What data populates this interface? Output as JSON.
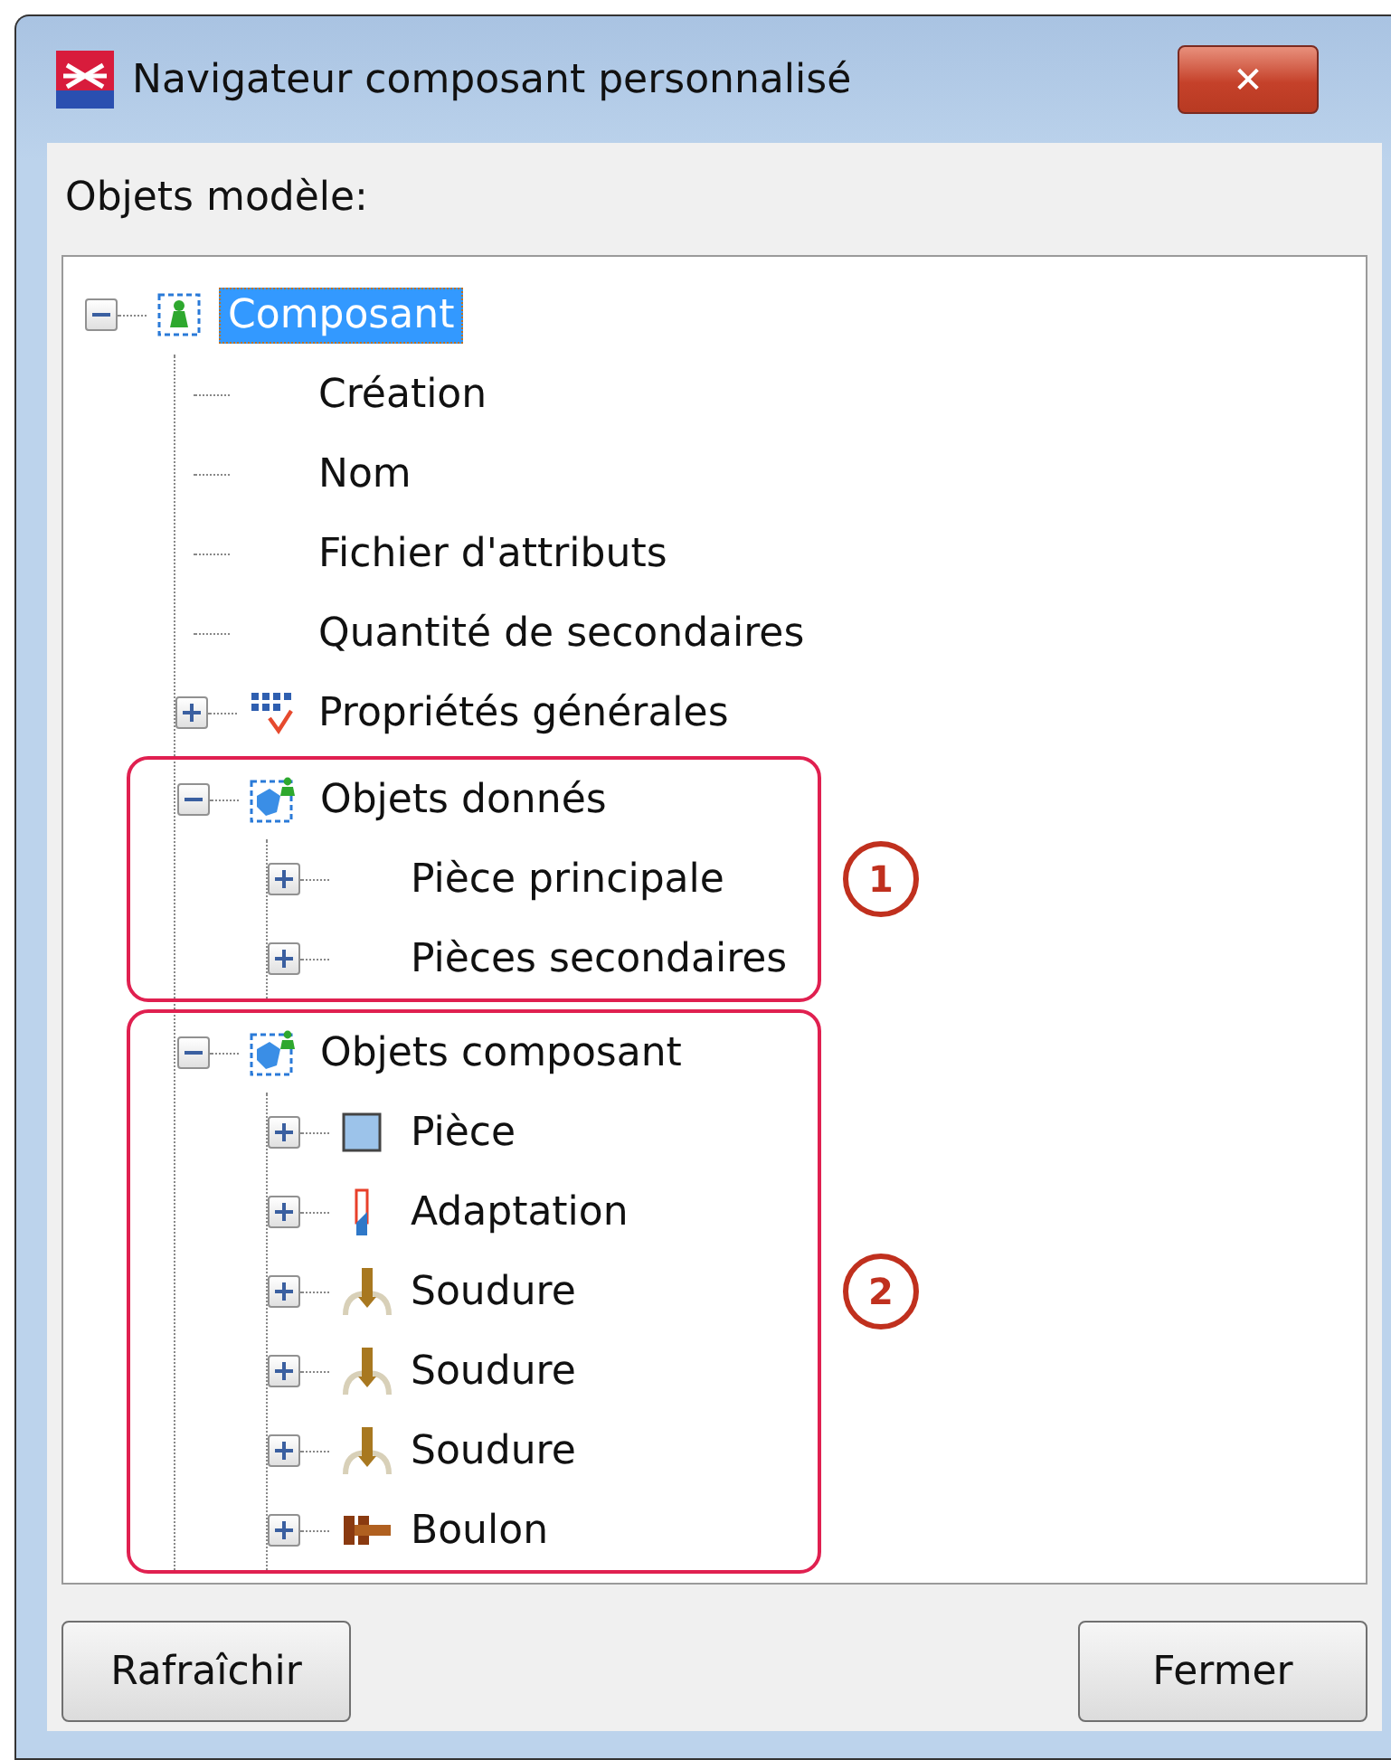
{
  "window": {
    "title": "Navigateur composant personnalisé",
    "close": "✕"
  },
  "label": "Objets modèle:",
  "tree": [
    {
      "label": "Composant",
      "kind": "component",
      "selected": true,
      "expanded": true,
      "children": [
        {
          "label": "Création",
          "selected": false
        },
        {
          "label": "Nom",
          "selected": false
        },
        {
          "label": "Fichier d'attributs",
          "selected": false
        },
        {
          "label": "Quantité de secondaires",
          "selected": false
        },
        {
          "label": "Propriétés générales",
          "kind": "properties",
          "selected": false,
          "expanded": false
        },
        {
          "label": "Objets donnés",
          "kind": "objects",
          "selected": false,
          "expanded": true,
          "callout": "1",
          "children": [
            {
              "label": "Pièce principale",
              "selected": false,
              "expanded": false
            },
            {
              "label": "Pièces secondaires",
              "selected": false,
              "expanded": false
            }
          ]
        },
        {
          "label": "Objets composant",
          "kind": "objects",
          "selected": false,
          "expanded": true,
          "callout": "2",
          "children": [
            {
              "label": "Pièce",
              "kind": "part",
              "selected": false,
              "expanded": false
            },
            {
              "label": "Adaptation",
              "kind": "fitting",
              "selected": false,
              "expanded": false
            },
            {
              "label": "Soudure",
              "kind": "weld",
              "selected": false,
              "expanded": false
            },
            {
              "label": "Soudure",
              "kind": "weld",
              "selected": false,
              "expanded": false
            },
            {
              "label": "Soudure",
              "kind": "weld",
              "selected": false,
              "expanded": false
            },
            {
              "label": "Boulon",
              "kind": "bolt",
              "selected": false,
              "expanded": false
            }
          ]
        }
      ]
    }
  ],
  "buttons": [
    "Rafraîchir",
    "Fermer"
  ]
}
